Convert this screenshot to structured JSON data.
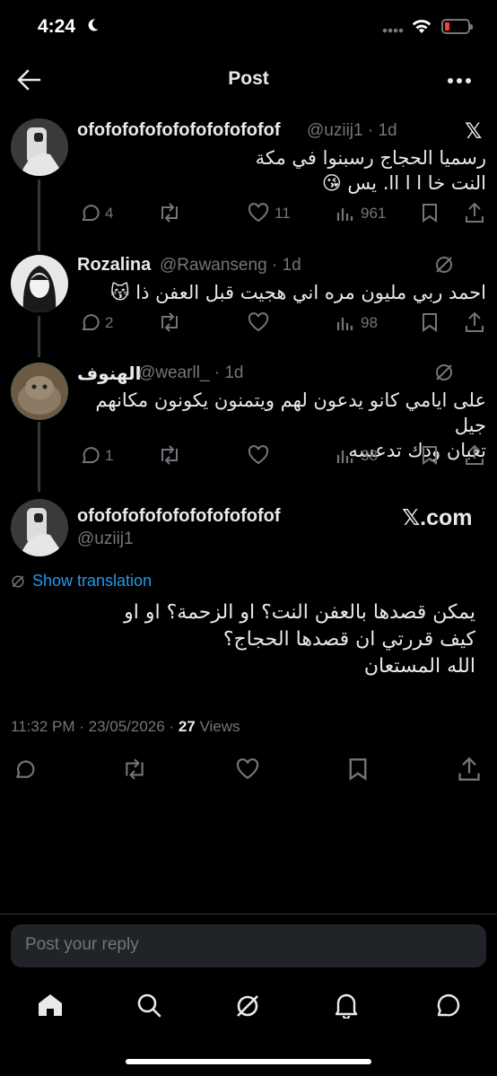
{
  "status_bar": {
    "time": "4:24"
  },
  "header": {
    "title": "Post"
  },
  "thread": [
    {
      "name": "ofofofofofofofofofofofof",
      "handle": "@uziij1 · 1d",
      "text_lines": [
        "رسميا الحجاج رسبنوا في مكة",
        "النت خا ا ا اا. يس 😘"
      ],
      "replies": "4",
      "likes": "11",
      "views": "961"
    },
    {
      "name": "Rozalina",
      "handle": "@Rawanseng · 1d",
      "text_lines": [
        "احمد ربي مليون مره اني هجيت قبل العفن ذا 😽"
      ],
      "replies": "2",
      "likes": "",
      "views": "98"
    },
    {
      "name": "الهنوف",
      "handle": "@wearll_ · 1d",
      "text_lines": [
        "على ايامي كانو يدعون لهم ويتمنون يكونون مكانهم جيل",
        "تعبان ودك تدعسه"
      ],
      "replies": "1",
      "likes": "",
      "views": "38"
    }
  ],
  "main_post": {
    "name": "ofofofofofofofofofofofof",
    "handle": "@uziij1",
    "badge": "𝕏.com",
    "show_translation": "Show translation",
    "text_lines": [
      "يمكن قصدها بالعفن النت؟ او الزحمة؟ او او",
      "كيف قررتي ان قصدها الحجاج؟",
      "الله المستعان"
    ],
    "timestamp": "11:32 PM · 23/05/2026 · ",
    "views_count": "27",
    "views_label": " Views"
  },
  "reply": {
    "placeholder": "Post your reply"
  },
  "icons": {
    "back": "back-arrow-icon",
    "more": "more-icon",
    "reply": "reply-icon",
    "retweet": "retweet-icon",
    "like": "heart-icon",
    "views": "views-icon",
    "bookmark": "bookmark-icon",
    "share": "share-icon",
    "tabs": [
      "home-icon",
      "search-icon",
      "grok-icon",
      "notifications-icon",
      "messages-icon"
    ]
  },
  "colors": {
    "accent": "#1d9bf0",
    "muted": "#71767b",
    "background": "#000000"
  }
}
